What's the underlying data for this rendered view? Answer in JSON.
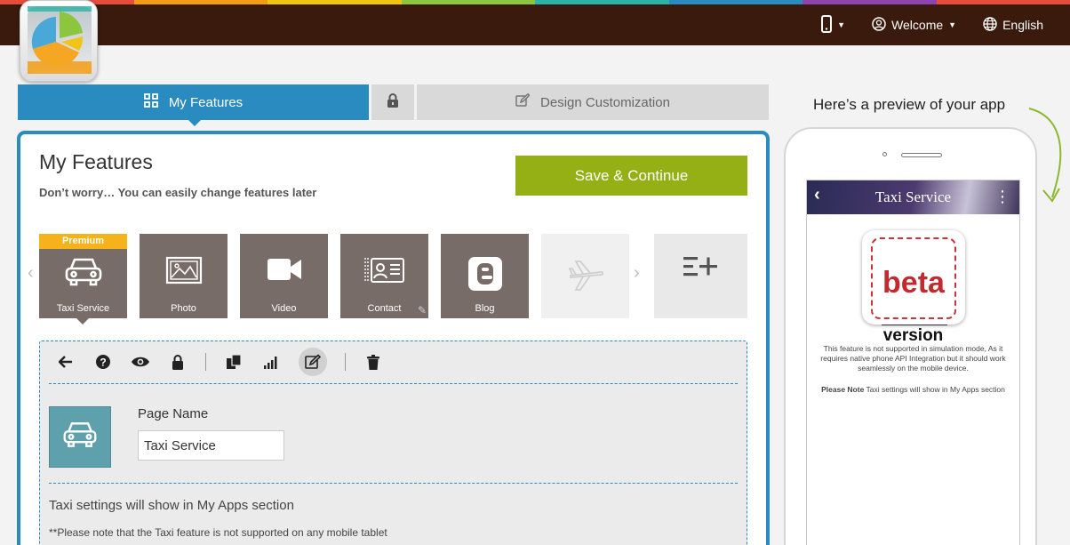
{
  "app": {
    "colors": {
      "top_bar": "#3a1a0c",
      "accent_blue": "#2a8bc0",
      "save_green": "#94b014",
      "tile_brown": "#786c68",
      "premium_yellow": "#f5b21b",
      "stripe": [
        "#e84c3d",
        "#f39c12",
        "#f1c40f",
        "#8cc63f",
        "#2ab3a6",
        "#2a8bc0",
        "#8e44ad",
        "#e84c3d"
      ]
    }
  },
  "topnav": {
    "device_icon": "mobile-phone-icon",
    "welcome_label": "Welcome",
    "language_label": "English"
  },
  "tabs": {
    "features_label": "My Features",
    "design_label": "Design Customization"
  },
  "panel": {
    "title": "My Features",
    "subtitle": "Don’t worry… You can easily change features later",
    "save_label": "Save & Continue"
  },
  "features": [
    {
      "label": "Taxi Service",
      "badge": "Premium",
      "icon": "car-icon"
    },
    {
      "label": "Photo",
      "icon": "photo-icon"
    },
    {
      "label": "Video",
      "icon": "video-camera-icon"
    },
    {
      "label": "Contact",
      "icon": "contact-card-icon"
    },
    {
      "label": "Blog",
      "icon": "blogger-icon"
    },
    {
      "label": "",
      "icon": "airplane-icon"
    },
    {
      "label": "",
      "icon": "add-more-icon"
    }
  ],
  "editor": {
    "page_name_label": "Page Name",
    "page_name_value": "Taxi Service",
    "info_main": "Taxi settings will show in My Apps section",
    "info_note": "**Please note that the Taxi feature is not supported on any mobile tablet"
  },
  "preview": {
    "label": "Here’s a preview of your app",
    "screen_title": "Taxi Service",
    "beta_word": "beta",
    "beta_version": "version",
    "message": "This feature is not supported in simulation mode, As it requires native phone API Integration but it should work seamlessly on the mobile device.",
    "note_bold": "Please Note",
    "note_text": " Taxi settings will show in My Apps section"
  }
}
